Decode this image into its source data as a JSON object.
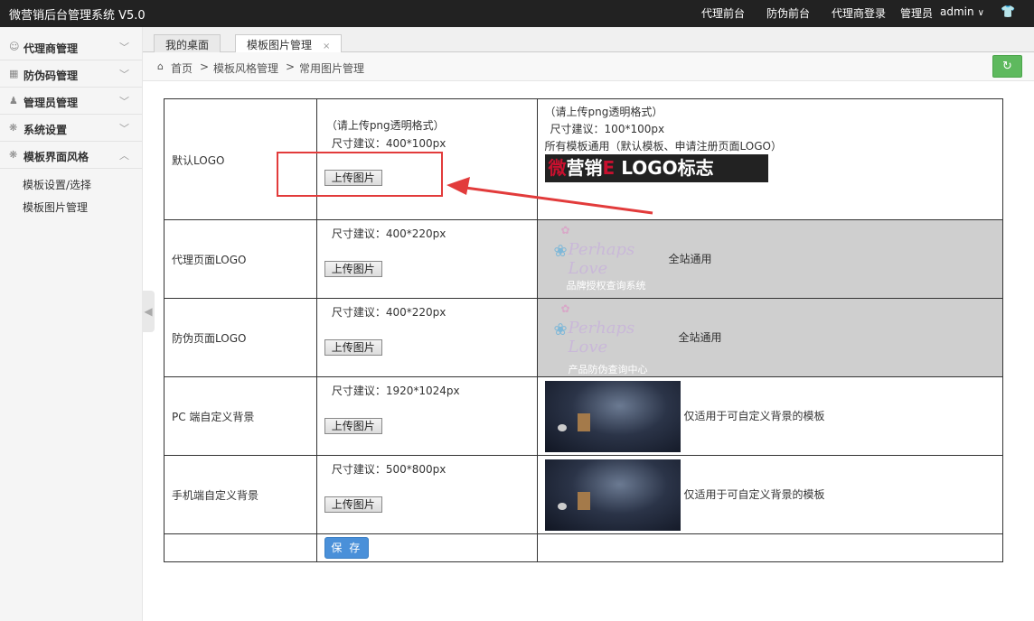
{
  "topbar": {
    "brand": "微营销后台管理系统 V5.0",
    "nav": [
      "代理前台",
      "防伪前台",
      "代理商登录"
    ],
    "role": "管理员",
    "user": "admin",
    "user_caret": "∨",
    "shirt_icon": "t-shirt-icon"
  },
  "sidebar": {
    "items": [
      {
        "label": "代理商管理",
        "icon": "user-icon",
        "chevron": "﹀"
      },
      {
        "label": "防伪码管理",
        "icon": "card-icon",
        "chevron": "﹀"
      },
      {
        "label": "管理员管理",
        "icon": "admin-icon",
        "chevron": "﹀"
      },
      {
        "label": "系统设置",
        "icon": "gear-icon",
        "chevron": "﹀"
      },
      {
        "label": "模板界面风格",
        "icon": "gear-icon",
        "chevron": "︿"
      }
    ],
    "subitems": [
      "模板设置/选择",
      "模板图片管理"
    ],
    "collapse_glyph": "◀"
  },
  "tabs": [
    {
      "label": "我的桌面",
      "closable": false
    },
    {
      "label": "模板图片管理",
      "closable": true,
      "close_glyph": "×"
    }
  ],
  "breadcrumb": {
    "items": [
      "首页",
      "模板风格管理",
      "常用图片管理"
    ],
    "separator": ">",
    "refresh_glyph": "↻"
  },
  "rows": [
    {
      "label": "默认LOGO",
      "hints": [
        "（请上传png透明格式）",
        "尺寸建议：400*100px"
      ],
      "upload": "上传图片",
      "preview_lines": [
        "（请上传png透明格式）",
        "尺寸建议：100*100px",
        "所有模板通用（默认模板、申请注册页面LOGO）"
      ],
      "logo_banner": {
        "prefix": "微",
        "middle": "营销",
        "sep": "E",
        "suffix": "LOGO标志"
      }
    },
    {
      "label": "代理页面LOGO",
      "hint": "尺寸建议：400*220px",
      "upload": "上传图片",
      "image_script": "Perhaps Love",
      "image_caption": "品牌授权查询系统",
      "note": "全站通用"
    },
    {
      "label": "防伪页面LOGO",
      "hint": "尺寸建议：400*220px",
      "upload": "上传图片",
      "image_script": "Perhaps Love",
      "image_caption": "产品防伪查询中心",
      "note": "全站通用"
    },
    {
      "label": "PC 端自定义背景",
      "hint": "尺寸建议：1920*1024px",
      "upload": "上传图片",
      "note": "仅适用于可自定义背景的模板"
    },
    {
      "label": "手机端自定义背景",
      "hint": "尺寸建议：500*800px",
      "upload": "上传图片",
      "note": "仅适用于可自定义背景的模板"
    }
  ],
  "save_label": "保 存",
  "colors": {
    "topbar_bg": "#222222",
    "save_blue": "#4a90d9",
    "refresh_green": "#5eb95e",
    "annotation_red": "#e23b3b"
  }
}
